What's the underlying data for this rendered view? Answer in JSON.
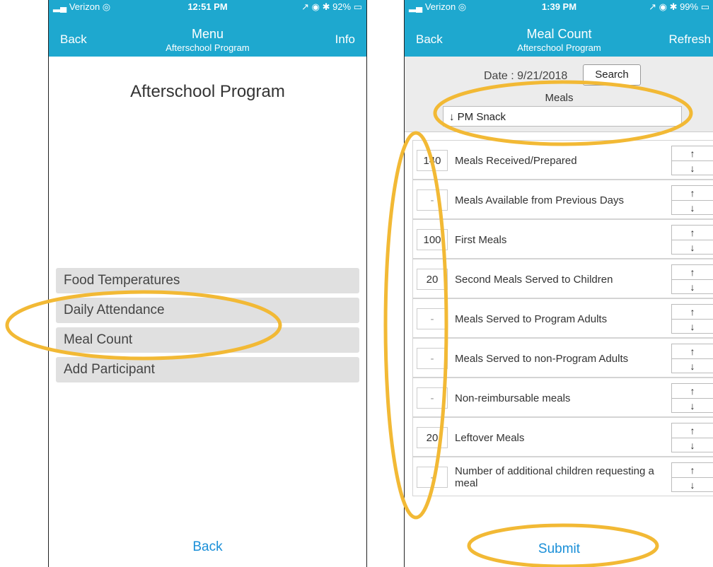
{
  "left": {
    "status": {
      "carrier": "▂▄ Verizon ◎",
      "time": "12:51 PM",
      "battery": "↗ ◉ ✱ 92% ▭"
    },
    "nav": {
      "back": "Back",
      "title": "Menu",
      "subtitle": "Afterschool Program",
      "info": "Info"
    },
    "program_title": "Afterschool Program",
    "menu": [
      "Food Temperatures",
      "Daily Attendance",
      "Meal Count",
      "Add Participant"
    ],
    "bottom_back": "Back"
  },
  "right": {
    "status": {
      "carrier": "▂▄ Verizon ◎",
      "time": "1:39 PM",
      "battery": "↗ ◉ ✱ 99% ▭"
    },
    "nav": {
      "back": "Back",
      "title": "Meal Count",
      "subtitle": "Afterschool Program",
      "refresh": "Refresh"
    },
    "date_label": "Date : 9/21/2018",
    "search": "Search",
    "meals_label": "Meals",
    "meals_selected": "↓  PM Snack",
    "rows": [
      {
        "value": "140",
        "label": "Meals Received/Prepared"
      },
      {
        "value": "-",
        "label": "Meals Available from Previous Days"
      },
      {
        "value": "100",
        "label": "First Meals"
      },
      {
        "value": "20",
        "label": "Second Meals Served to Children"
      },
      {
        "value": "-",
        "label": "Meals Served to Program Adults"
      },
      {
        "value": "-",
        "label": "Meals Served to non-Program Adults"
      },
      {
        "value": "-",
        "label": "Non-reimbursable meals"
      },
      {
        "value": "20",
        "label": "Leftover Meals"
      },
      {
        "value": "-",
        "label": "Number of additional children requesting a meal"
      }
    ],
    "step_up": "↑",
    "step_down": "↓",
    "submit": "Submit"
  },
  "colors": {
    "header": "#1ea8cf",
    "link": "#1a8fd8",
    "highlight": "#f2b935"
  }
}
